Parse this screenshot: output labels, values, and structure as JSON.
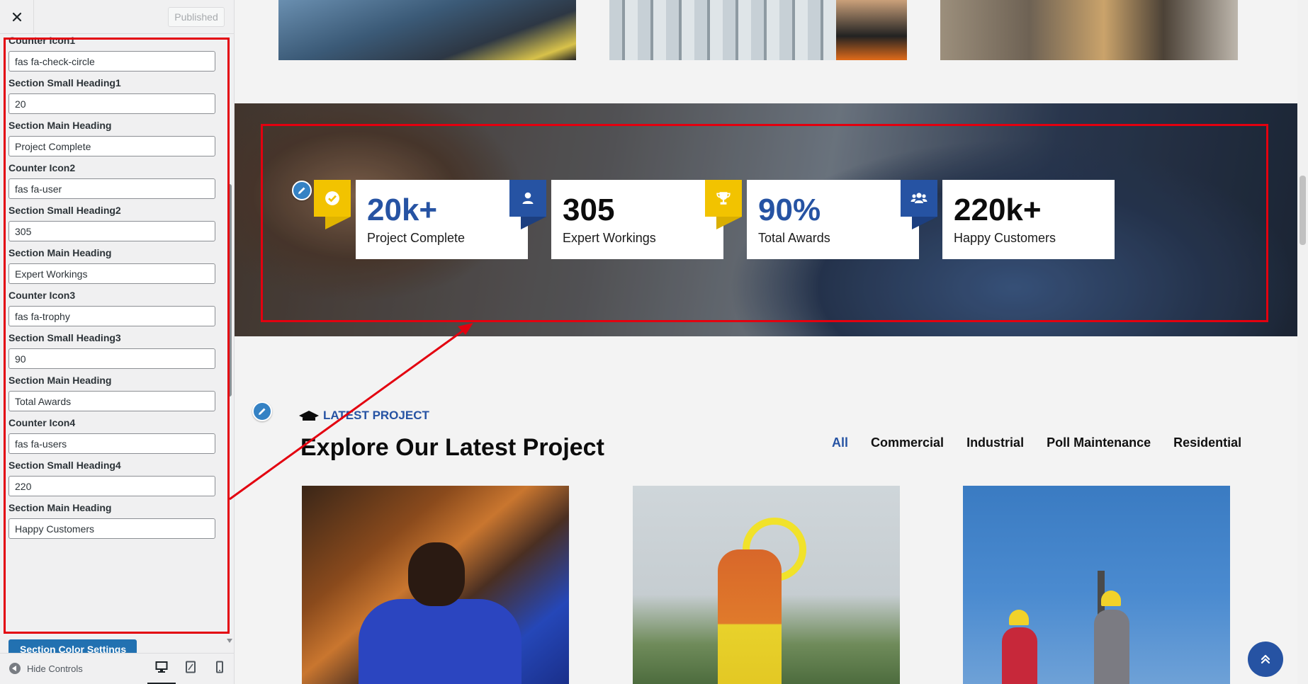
{
  "header": {
    "close_label": "×",
    "publish_label": "Published"
  },
  "sidebar": {
    "fields": [
      {
        "label": "Counter Icon1",
        "value": "fas fa-check-circle"
      },
      {
        "label": "Section Small Heading1",
        "value": "20"
      },
      {
        "label": "Section Main Heading",
        "value": "Project Complete"
      },
      {
        "label": "Counter Icon2",
        "value": "fas fa-user"
      },
      {
        "label": "Section Small Heading2",
        "value": "305"
      },
      {
        "label": "Section Main Heading",
        "value": "Expert Workings"
      },
      {
        "label": "Counter Icon3",
        "value": "fas fa-trophy"
      },
      {
        "label": "Section Small Heading3",
        "value": "90"
      },
      {
        "label": "Section Main Heading",
        "value": "Total Awards"
      },
      {
        "label": "Counter Icon4",
        "value": "fas fa-users"
      },
      {
        "label": "Section Small Heading4",
        "value": "220"
      },
      {
        "label": "Section Main Heading",
        "value": "Happy Customers"
      }
    ],
    "color_settings_label": "Section Color Settings"
  },
  "footer": {
    "hide_controls_label": "Hide Controls",
    "devices": [
      "desktop-icon",
      "tablet-icon",
      "mobile-icon"
    ]
  },
  "counters": [
    {
      "icon": "check-circle-icon",
      "number": "20k+",
      "label": "Project Complete",
      "color": "#f2c300",
      "num_color": "#2653a3"
    },
    {
      "icon": "user-icon",
      "number": "305",
      "label": "Expert Workings",
      "color": "#2653a3",
      "num_color": "#0c0c0c"
    },
    {
      "icon": "trophy-icon",
      "number": "90%",
      "label": "Total Awards",
      "color": "#f2c300",
      "num_color": "#2653a3"
    },
    {
      "icon": "users-icon",
      "number": "220k+",
      "label": "Happy Customers",
      "color": "#2653a3",
      "num_color": "#0c0c0c"
    }
  ],
  "projects": {
    "kicker": "LATEST PROJECT",
    "title": "Explore Our Latest Project",
    "filters": [
      "All",
      "Commercial",
      "Industrial",
      "Poll Maintenance",
      "Residential"
    ],
    "active_filter": "All"
  },
  "colors": {
    "accent_blue": "#2653a3",
    "accent_yellow": "#f2c300",
    "highlight_red": "#e3000f",
    "wp_blue": "#2271b1"
  }
}
